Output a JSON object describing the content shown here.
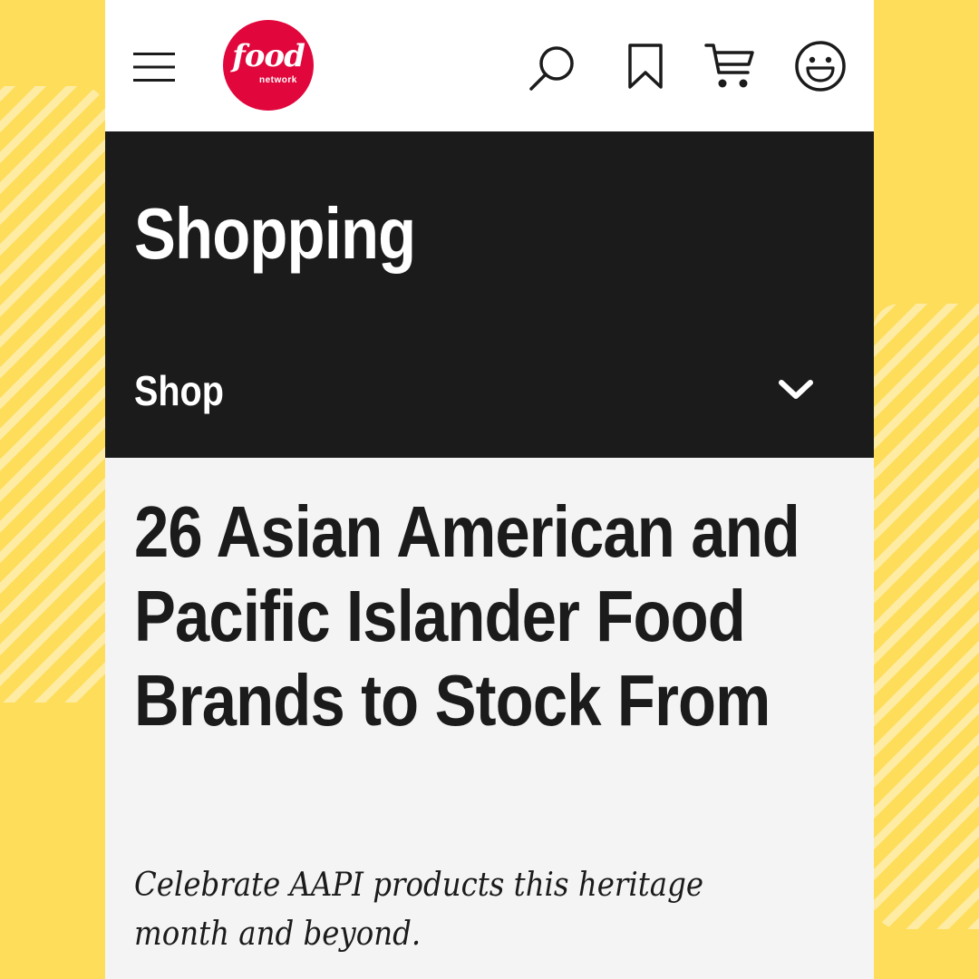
{
  "brand": {
    "logo_word": "food",
    "logo_sub": "network",
    "logo_color": "#E1063B"
  },
  "header": {
    "icons": [
      "hamburger-menu-icon",
      "search-icon",
      "bookmark-icon",
      "cart-icon",
      "smiley-account-icon"
    ]
  },
  "section": {
    "title": "Shopping",
    "subnav_label": "Shop",
    "subnav_icon": "chevron-down-icon"
  },
  "article": {
    "title": "26 Asian American and Pacific Islander Food Brands to Stock From",
    "dek": "Celebrate AAPI products this heritage month and beyond."
  },
  "colors": {
    "background": "#FEDD5A",
    "header_bg": "#FFFFFF",
    "banner_bg": "#1B1B1B",
    "content_bg": "#F4F4F4",
    "text": "#1B1B1B"
  }
}
